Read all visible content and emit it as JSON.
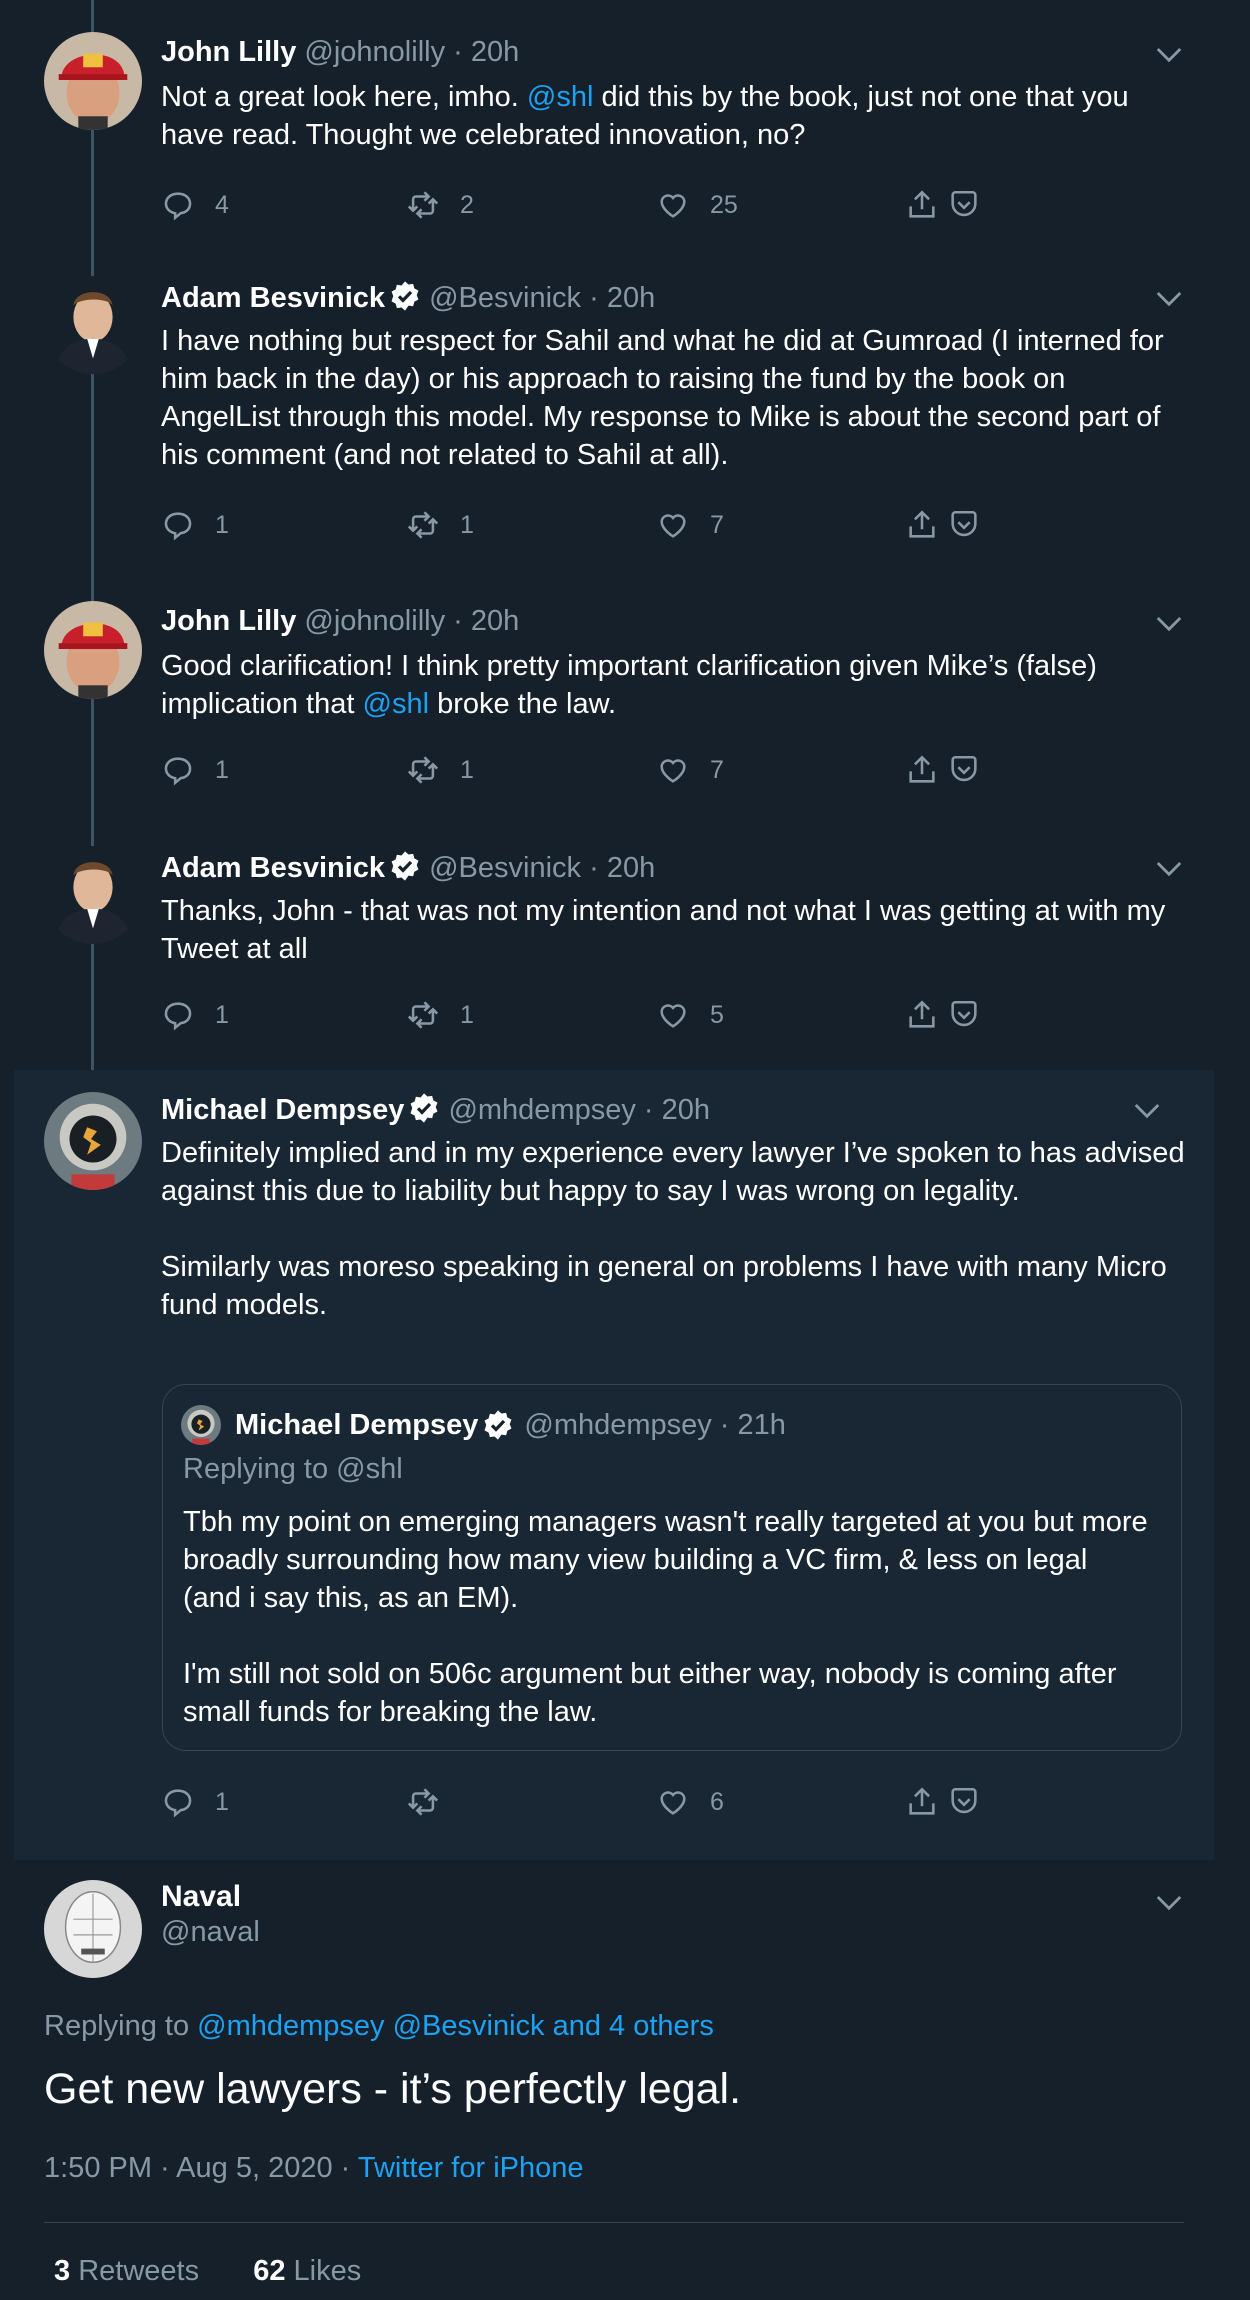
{
  "tweets": [
    {
      "name": "John Lilly",
      "handle": "@johnolilly",
      "time": "· 20h",
      "body_parts": [
        "Not a great look here, imho. ",
        "@shl",
        " did this by the book, just not one that you have read. Thought we celebrated innovation, no?"
      ],
      "replies": "4",
      "retweets": "2",
      "likes": "25"
    },
    {
      "name": "Adam Besvinick",
      "handle": "@Besvinick",
      "time": "· 20h",
      "body": "I have nothing but respect for Sahil and what he did at Gumroad (I interned for him back in the day) or his approach to raising the fund by the book on AngelList through this model. My response to Mike is about the second part of his comment (and not related to Sahil at all).",
      "replies": "1",
      "retweets": "1",
      "likes": "7"
    },
    {
      "name": "John Lilly",
      "handle": "@johnolilly",
      "time": "· 20h",
      "body_parts": [
        "Good clarification! I think pretty important clarification given Mike’s (false) implication that ",
        "@shl",
        " broke the law."
      ],
      "replies": "1",
      "retweets": "1",
      "likes": "7"
    },
    {
      "name": "Adam Besvinick",
      "handle": "@Besvinick",
      "time": "· 20h",
      "body": "Thanks, John - that was not my intention and not what I was getting at with my Tweet at all",
      "replies": "1",
      "retweets": "1",
      "likes": "5"
    },
    {
      "name": "Michael Dempsey",
      "handle": "@mhdempsey",
      "time": "· 20h",
      "body_p1": "Definitely implied and in my experience every lawyer I’ve spoken to has advised against this due to liability but happy to say I was wrong on legality.",
      "body_p2": "Similarly was moreso speaking in general on problems I have with many Micro fund models.",
      "quote": {
        "name": "Michael Dempsey",
        "handle": "@mhdempsey",
        "time": "· 21h",
        "replying": "Replying to @shl",
        "p1": "Tbh my point on emerging managers wasn't really targeted at you but more broadly surrounding how many view building a VC firm, & less on legal (and i say this, as an EM).",
        "p2": "I'm still not sold on 506c argument but either way, nobody is coming after small funds for breaking the law."
      },
      "replies": "1",
      "retweets": "",
      "likes": "6"
    }
  ],
  "main": {
    "name": "Naval",
    "handle": "@naval",
    "replying_prefix": "Replying to ",
    "replying_mentions": "@mhdempsey @Besvinick and 4 others",
    "text": "Get new lawyers - it’s perfectly legal.",
    "time": "1:50 PM · Aug 5, 2020 · ",
    "source": "Twitter for iPhone",
    "retweets_count": "3",
    "retweets_label": " Retweets",
    "likes_count": "62",
    "likes_label": " Likes"
  },
  "colors": {
    "background": "#15202b",
    "accent": "#1da1f2",
    "muted": "#8899a6",
    "highlight": "#192734"
  },
  "icons": [
    "reply-icon",
    "retweet-icon",
    "like-icon",
    "share-icon",
    "bookmark-icon",
    "verified-icon",
    "chevron-down-icon"
  ]
}
